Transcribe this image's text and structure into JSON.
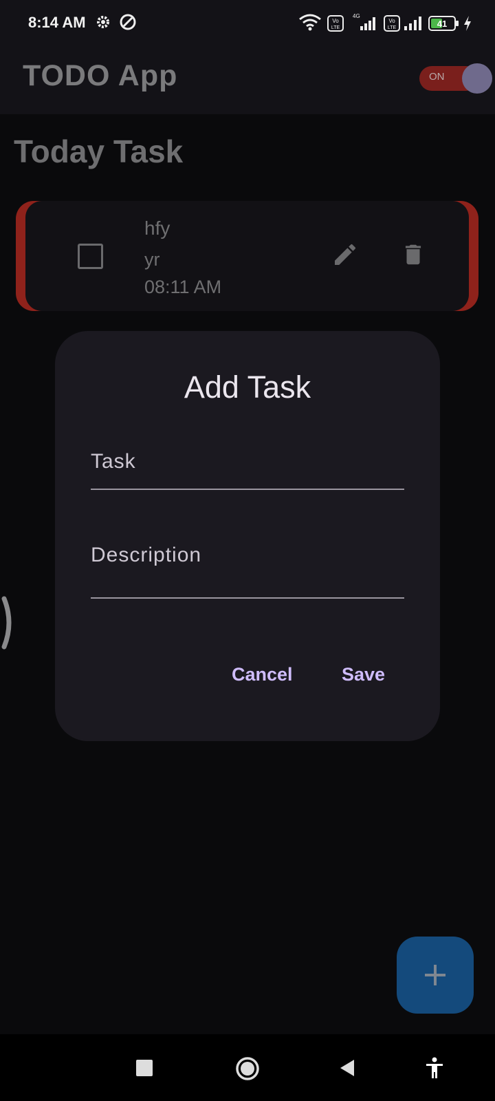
{
  "status_bar": {
    "time": "8:14 AM",
    "battery": "41",
    "network": "4G",
    "icons": [
      "settings-icon",
      "data-saver-icon",
      "wifi-icon",
      "volte-icon",
      "signal-icon",
      "battery-icon",
      "charging-icon"
    ]
  },
  "app_bar": {
    "title": "TODO App",
    "toggle_label": "ON"
  },
  "section": {
    "title": "Today Task"
  },
  "tasks": [
    {
      "title": "hfy",
      "description": "yr",
      "time": "08:11 AM"
    }
  ],
  "dialog": {
    "title": "Add Task",
    "task_label": "Task",
    "description_label": "Description",
    "cancel_label": "Cancel",
    "save_label": "Save"
  },
  "colors": {
    "accent": "#cfbcfb",
    "card_border": "#8f221b",
    "fab": "#144a7c"
  }
}
